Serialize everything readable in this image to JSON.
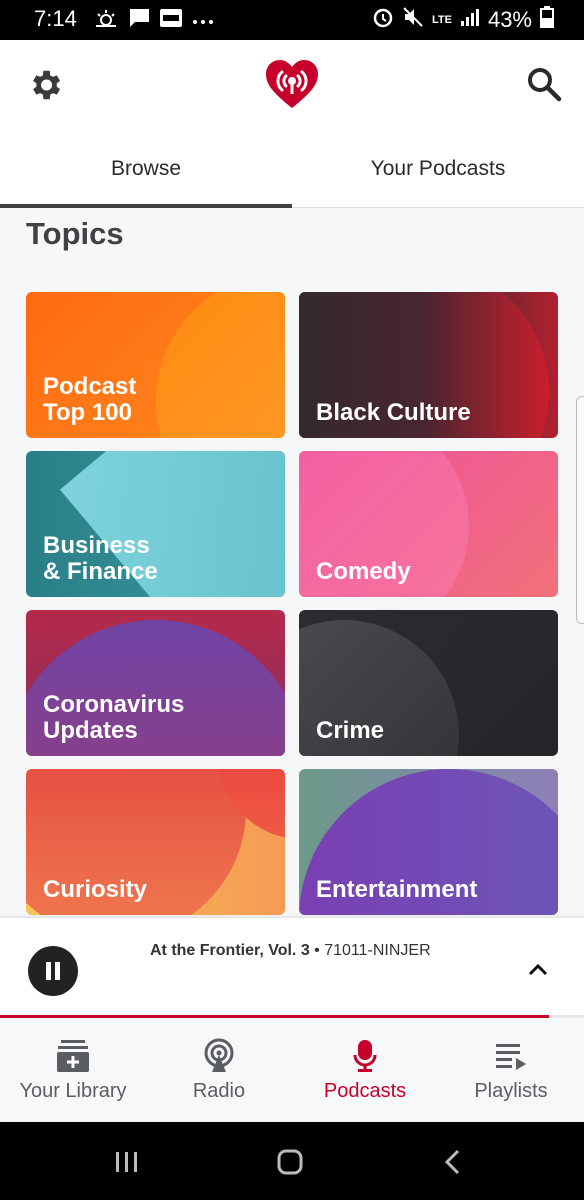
{
  "status_bar": {
    "time": "7:14",
    "battery": "43%",
    "network": "LTE",
    "left_icons": [
      "weather-icon",
      "message-icon",
      "imdb-icon",
      "more-dots-icon"
    ],
    "right_icons": [
      "alarm-icon",
      "mute-icon",
      "lte-icon",
      "signal-icon",
      "battery-icon"
    ]
  },
  "header": {
    "settings_icon": "gear-icon",
    "logo_icon": "iheart-logo-icon",
    "search_icon": "search-icon",
    "brand_color": "#c6002b"
  },
  "tabs": [
    {
      "label": "Browse",
      "active": true
    },
    {
      "label": "Your Podcasts",
      "active": false
    }
  ],
  "section": {
    "title": "Topics"
  },
  "topics": [
    {
      "label": "Podcast\nTop 100"
    },
    {
      "label": "Black Culture"
    },
    {
      "label": "Business\n& Finance"
    },
    {
      "label": "Comedy"
    },
    {
      "label": "Coronavirus\nUpdates"
    },
    {
      "label": "Crime"
    },
    {
      "label": "Curiosity"
    },
    {
      "label": "Entertainment"
    }
  ],
  "player": {
    "title": "At the Frontier, Vol. 3",
    "separator": " • ",
    "artist": "71011-NINJER",
    "progress": 0.94,
    "pause_icon": "pause-icon",
    "expand_icon": "chevron-up-icon"
  },
  "bottom_nav": [
    {
      "label": "Your Library",
      "icon": "library-icon",
      "active": false
    },
    {
      "label": "Radio",
      "icon": "radio-icon",
      "active": false
    },
    {
      "label": "Podcasts",
      "icon": "microphone-icon",
      "active": true
    },
    {
      "label": "Playlists",
      "icon": "playlist-icon",
      "active": false
    }
  ],
  "system_nav": [
    "recents-icon",
    "home-icon",
    "back-icon"
  ]
}
